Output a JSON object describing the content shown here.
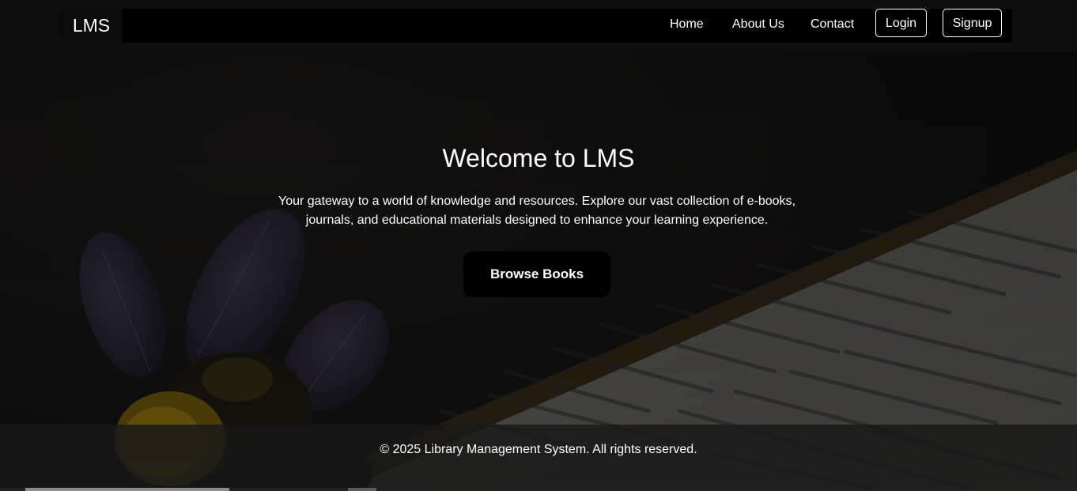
{
  "navbar": {
    "brand": "LMS",
    "links": {
      "home": "Home",
      "about": "About Us",
      "contact": "Contact"
    },
    "login_label": "Login",
    "signup_label": "Signup"
  },
  "hero": {
    "title": "Welcome to LMS",
    "description": "Your gateway to a world of knowledge and resources. Explore our vast collection of e-books, journals, and educational materials designed to enhance your learning experience.",
    "cta_label": "Browse Books"
  },
  "footer": {
    "copyright": "© 2025 Library Management System. All rights reserved."
  },
  "colors": {
    "navbar_bg": "#0e0e0e",
    "text": "#ffffff",
    "button_bg": "#000000",
    "bee_yellow": "#e0b21a"
  }
}
